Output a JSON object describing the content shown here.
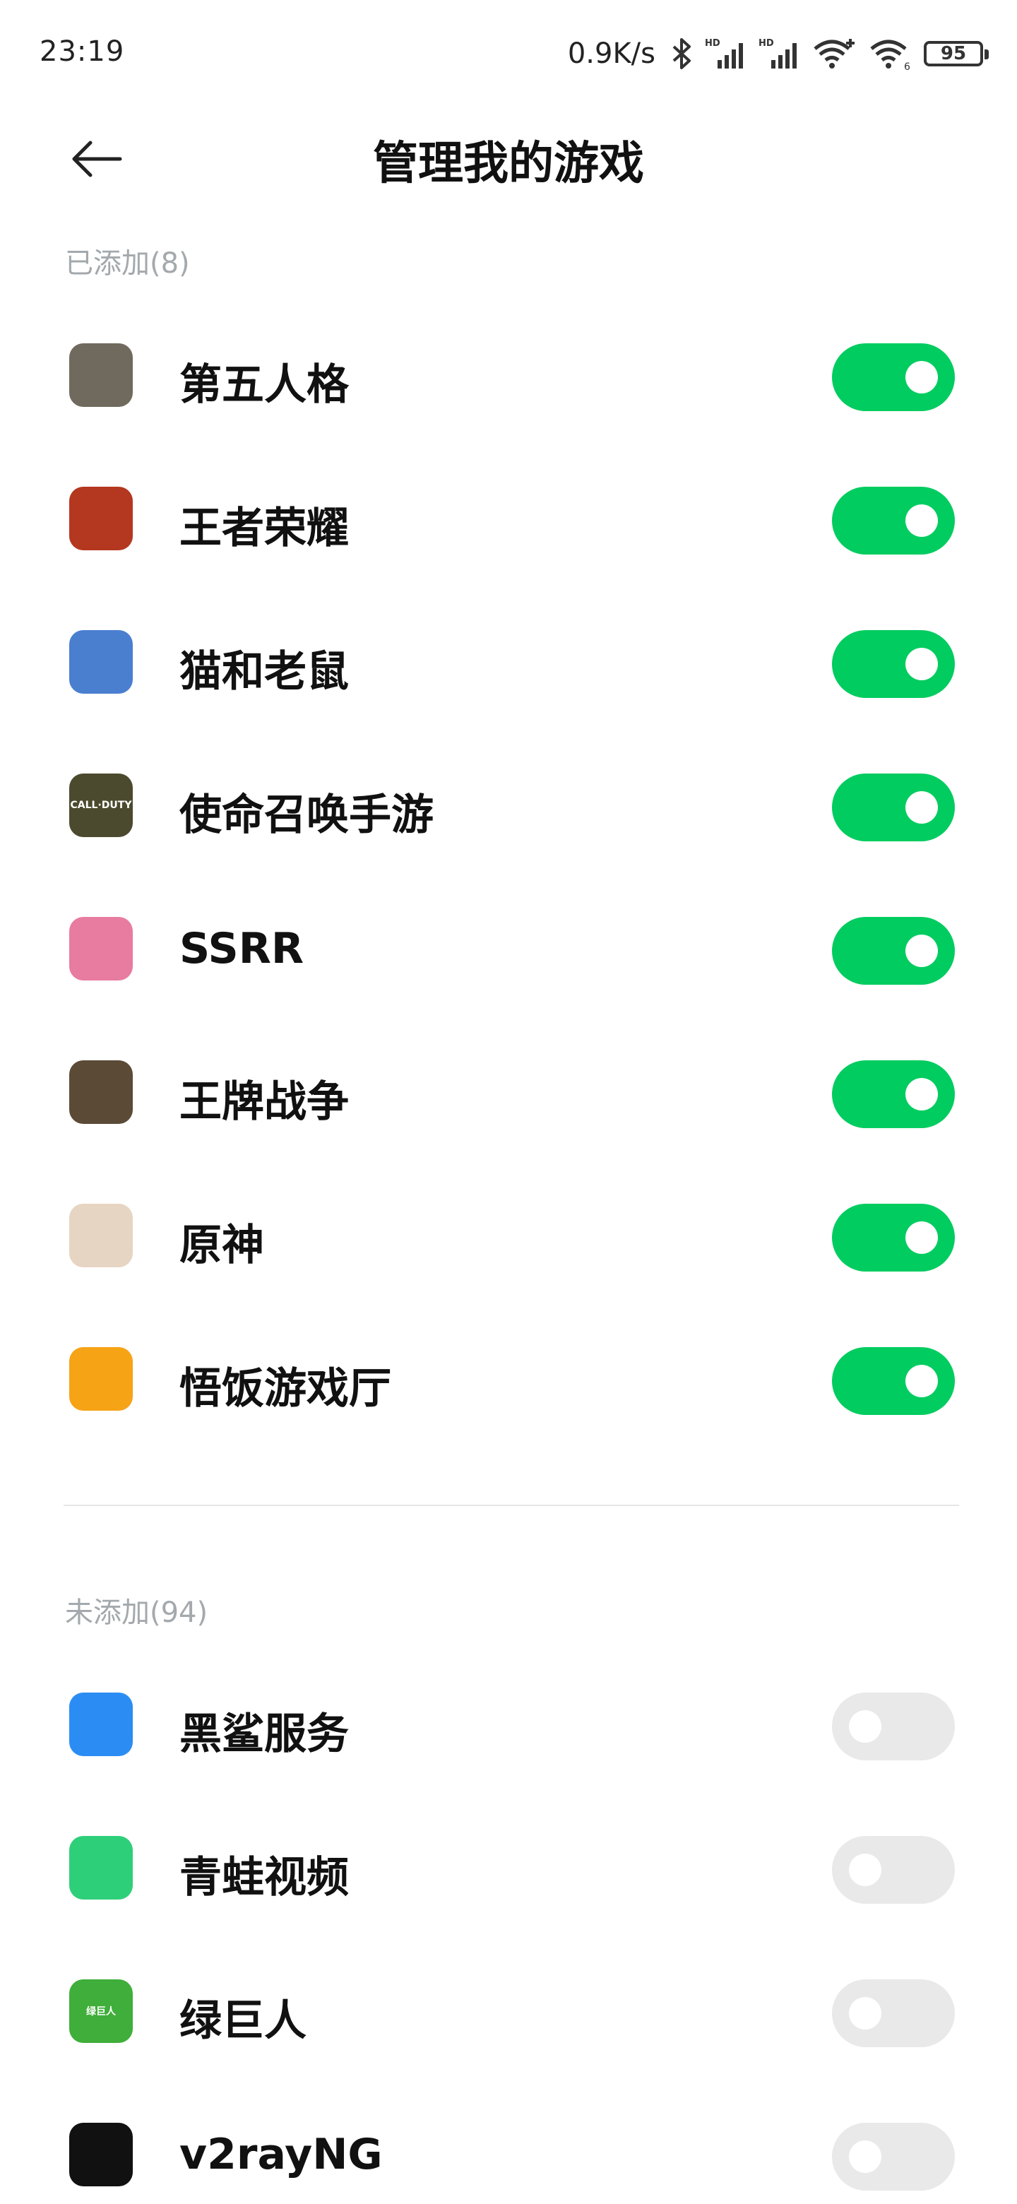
{
  "status_bar": {
    "time": "23:19",
    "net_speed": "0.9K/s",
    "hd_label": "HD",
    "battery": "95",
    "wifi_badge": "6",
    "icons": [
      "bluetooth-icon",
      "signal-hd-icon",
      "signal-hd-icon",
      "wifi-plus-icon",
      "wifi-icon",
      "battery-icon"
    ]
  },
  "header": {
    "title": "管理我的游戏",
    "back_icon": "back-arrow-icon"
  },
  "sections": {
    "added_label": "已添加(8)",
    "not_added_label": "未添加(94)"
  },
  "added_apps": [
    {
      "name": "第五人格",
      "enabled": true,
      "icon_color": "#6f6a5d"
    },
    {
      "name": "王者荣耀",
      "enabled": true,
      "icon_color": "#b4371f"
    },
    {
      "name": "猫和老鼠",
      "enabled": true,
      "icon_color": "#4a7fd0"
    },
    {
      "name": "使命召唤手游",
      "enabled": true,
      "icon_color": "#4b4a2e",
      "icon_text": "CALL·DUTY"
    },
    {
      "name": "SSRR",
      "enabled": true,
      "icon_color": "#e87ca0"
    },
    {
      "name": "王牌战争",
      "enabled": true,
      "icon_color": "#5b4a36"
    },
    {
      "name": "原神",
      "enabled": true,
      "icon_color": "#e6d5c2"
    },
    {
      "name": "悟饭游戏厅",
      "enabled": true,
      "icon_color": "#f6a316"
    }
  ],
  "not_added_apps": [
    {
      "name": "黑鲨服务",
      "enabled": false,
      "icon_color": "#2b8df3"
    },
    {
      "name": "青蛙视频",
      "enabled": false,
      "icon_color": "#2ecf79"
    },
    {
      "name": "绿巨人",
      "enabled": false,
      "icon_color": "#3fae3a",
      "icon_text": "绿巨人"
    },
    {
      "name": "v2rayNG",
      "enabled": false,
      "icon_color": "#111111"
    }
  ],
  "colors": {
    "toggle_on": "#00cc5f",
    "toggle_off": "#e9e9e9",
    "section_label": "#a3a9ad"
  }
}
